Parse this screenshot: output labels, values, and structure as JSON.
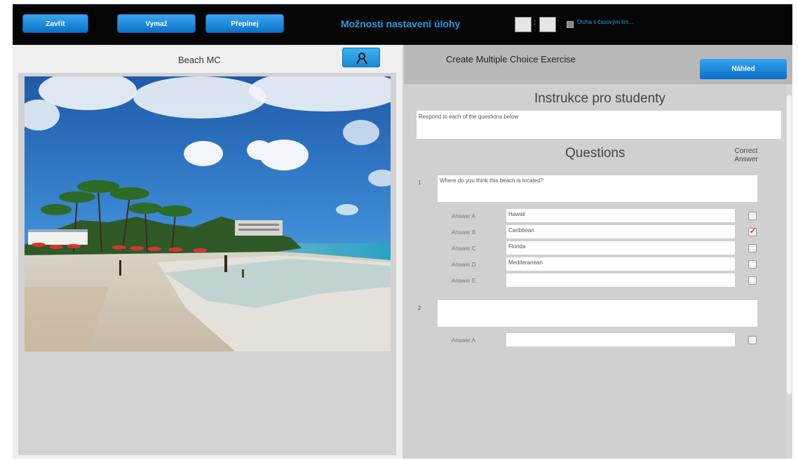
{
  "toolbar": {
    "close_label": "Zavřít",
    "delete_label": "Vymaž",
    "switch_label": "Přepínej",
    "title": "Možnosti nastavení úlohy",
    "timed_task_label": "Úloha s časovým lim..."
  },
  "media_panel": {
    "title": "Beach MC",
    "media_button_icon": "person-search-icon",
    "image_alt": "beach-photo"
  },
  "editor": {
    "title": "Create Multiple Choice Exercise",
    "preview_label": "Náhled",
    "instructions_heading": "Instrukce pro studenty",
    "instructions_text": "Respond to each of the questions below",
    "questions_heading": "Questions",
    "correct_answer_heading_1": "Correct",
    "correct_answer_heading_2": "Answer",
    "questions": [
      {
        "number": "1",
        "text": "Where do you think this beach is located?",
        "answers": [
          {
            "label": "Answer A",
            "value": "Hawaii",
            "correct": false
          },
          {
            "label": "Answer B",
            "value": "Caribbean",
            "correct": true
          },
          {
            "label": "Answer C",
            "value": "Florida",
            "correct": false
          },
          {
            "label": "Answer D",
            "value": "Mediteranean",
            "correct": false
          },
          {
            "label": "Answer E",
            "value": "",
            "correct": false
          }
        ]
      },
      {
        "number": "2",
        "text": "",
        "answers": [
          {
            "label": "Answer A",
            "value": "",
            "correct": false
          }
        ]
      }
    ]
  }
}
